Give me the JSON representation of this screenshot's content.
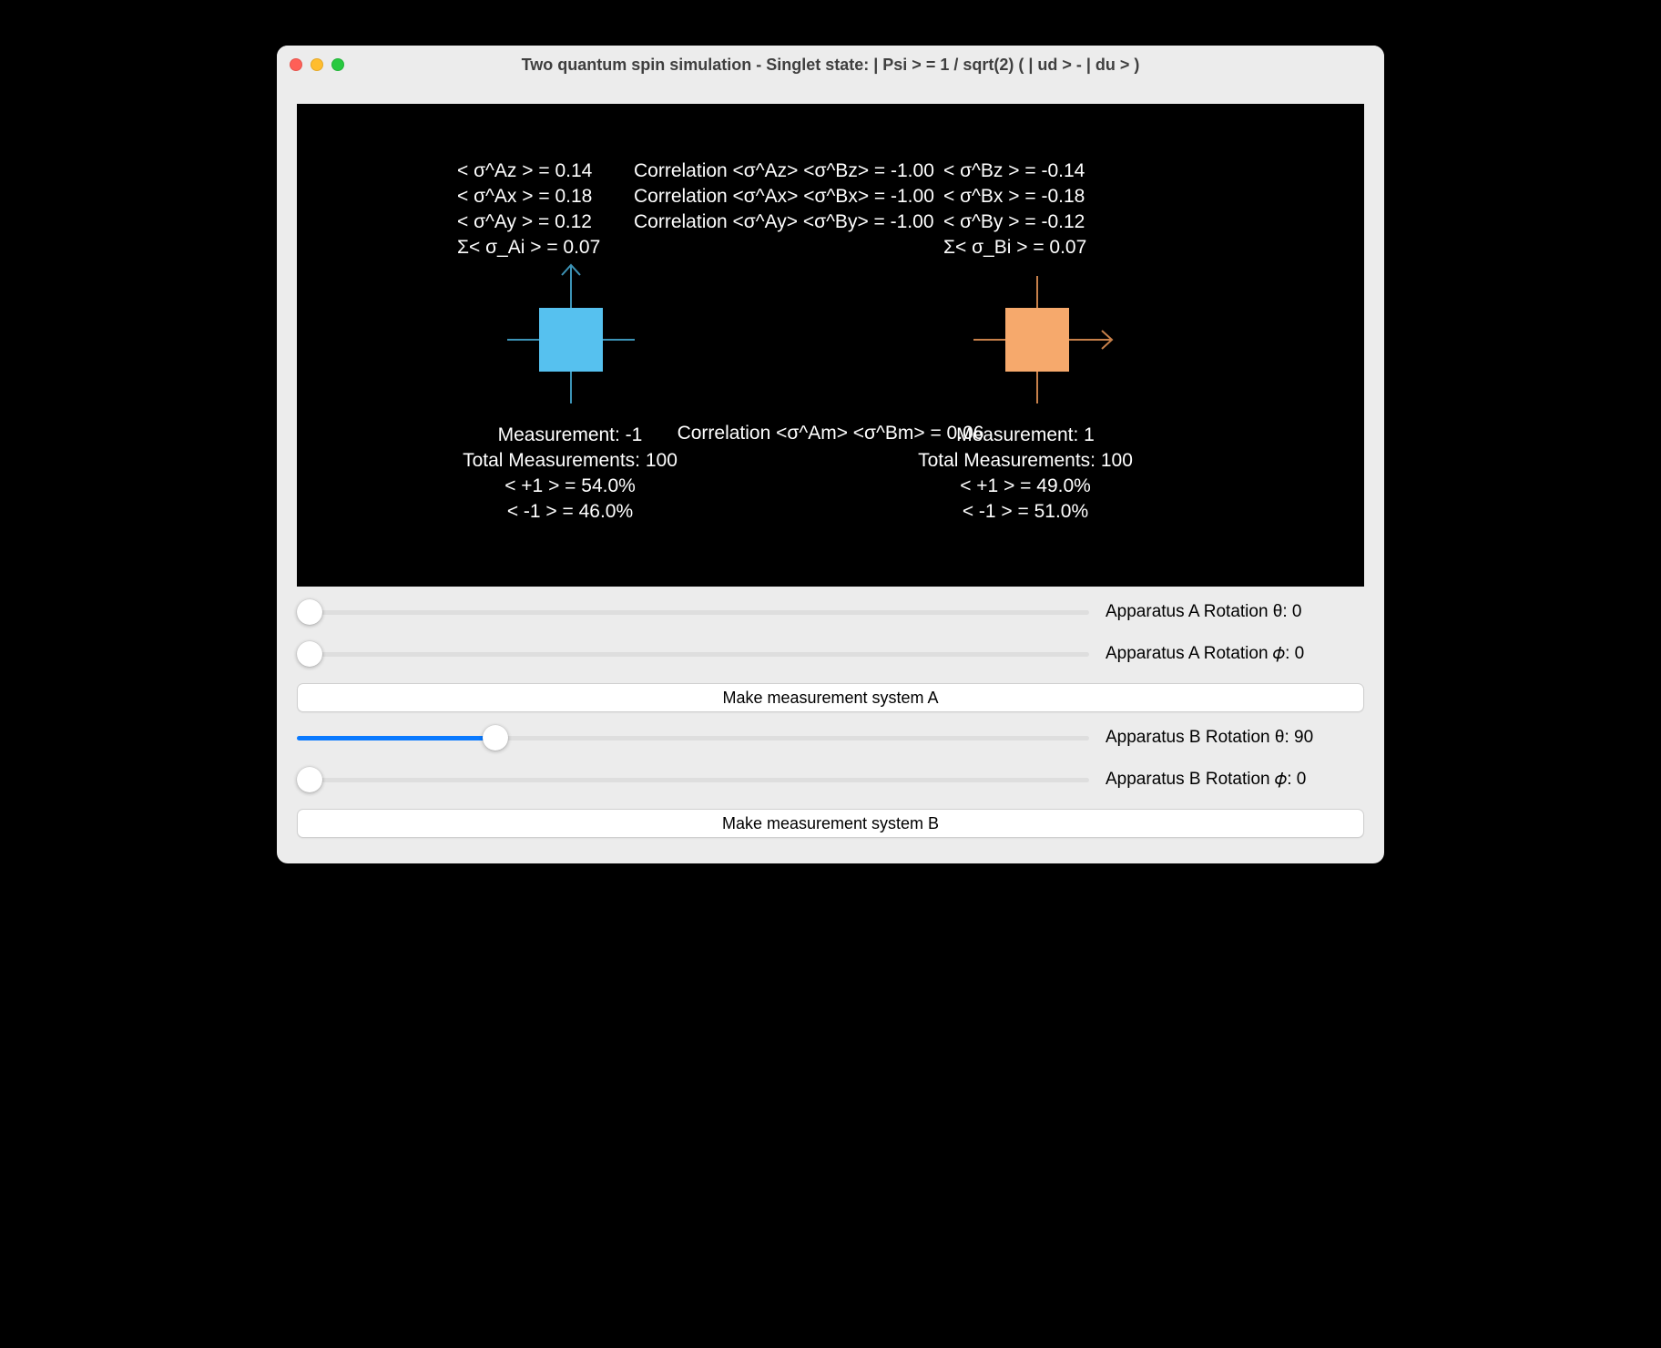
{
  "window": {
    "title": "Two quantum spin simulation - Singlet state: | Psi > = 1 / sqrt(2) ( | ud > - | du > )"
  },
  "stats": {
    "A": {
      "sigma_z": "< σ^Az > = 0.14",
      "sigma_x": "< σ^Ax > = 0.18",
      "sigma_y": "< σ^Ay > = 0.12",
      "sigma_sum": "Σ< σ_Ai > = 0.07"
    },
    "B": {
      "sigma_z": "< σ^Bz > = -0.14",
      "sigma_x": "< σ^Bx > = -0.18",
      "sigma_y": "< σ^By > = -0.12",
      "sigma_sum": "Σ< σ_Bi > = 0.07"
    },
    "corr": {
      "z": "Correlation <σ^Az> <σ^Bz> = -1.00",
      "x": "Correlation <σ^Ax> <σ^Bx> = -1.00",
      "y": "Correlation <σ^Ay> <σ^By> = -1.00",
      "m": "Correlation <σ^Am> <σ^Bm> = 0.06"
    }
  },
  "measurements": {
    "A": {
      "result": "Measurement: -1",
      "total": "Total Measurements: 100",
      "plus": "< +1 > = 54.0%",
      "minus": "< -1 > = 46.0%"
    },
    "B": {
      "result": "Measurement: 1",
      "total": "Total Measurements: 100",
      "plus": "< +1 > = 49.0%",
      "minus": "< -1 > = 51.0%"
    }
  },
  "apparatus": {
    "A": {
      "color": "#56c1ef",
      "stroke": "#3d94b7",
      "rotation": 0
    },
    "B": {
      "color": "#f6a96c",
      "stroke": "#c7804a",
      "rotation": 90
    }
  },
  "sliders": {
    "A_theta": {
      "label": "Apparatus A Rotation θ: 0",
      "pct": 0
    },
    "A_phi": {
      "label": "Apparatus A Rotation 𝜙: 0",
      "pct": 0
    },
    "B_theta": {
      "label": "Apparatus B Rotation θ: 90",
      "pct": 25
    },
    "B_phi": {
      "label": "Apparatus B Rotation 𝜙: 0",
      "pct": 0
    }
  },
  "buttons": {
    "measure_A": "Make measurement system A",
    "measure_B": "Make measurement system B"
  }
}
